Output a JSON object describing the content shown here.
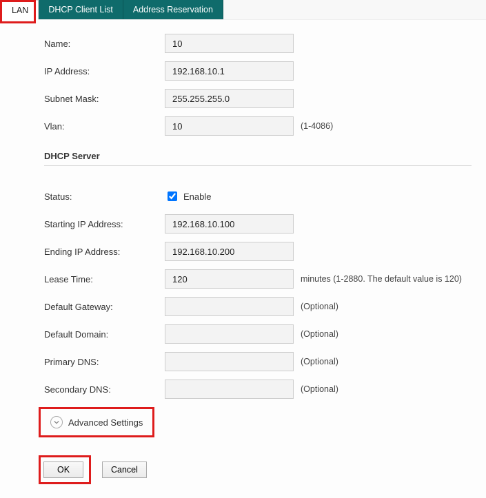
{
  "tabs": {
    "lan": "LAN",
    "dhcp": "DHCP Client List",
    "res": "Address Reservation"
  },
  "labels": {
    "name": "Name:",
    "ip": "IP Address:",
    "mask": "Subnet Mask:",
    "vlan": "Vlan:",
    "status": "Status:",
    "startip": "Starting IP Address:",
    "endip": "Ending IP Address:",
    "lease": "Lease Time:",
    "gw": "Default Gateway:",
    "domain": "Default Domain:",
    "pdns": "Primary DNS:",
    "sdns": "Secondary DNS:"
  },
  "values": {
    "name": "10",
    "ip": "192.168.10.1",
    "mask": "255.255.255.0",
    "vlan": "10",
    "startip": "192.168.10.100",
    "endip": "192.168.10.200",
    "lease": "120",
    "gw": "",
    "domain": "",
    "pdns": "",
    "sdns": ""
  },
  "hints": {
    "vlan": "(1-4086)",
    "lease": "minutes (1-2880. The default value is 120)",
    "optional": "(Optional)"
  },
  "section": {
    "dhcp": "DHCP Server"
  },
  "enable_label": "Enable",
  "advanced": "Advanced Settings",
  "buttons": {
    "ok": "OK",
    "cancel": "Cancel"
  }
}
